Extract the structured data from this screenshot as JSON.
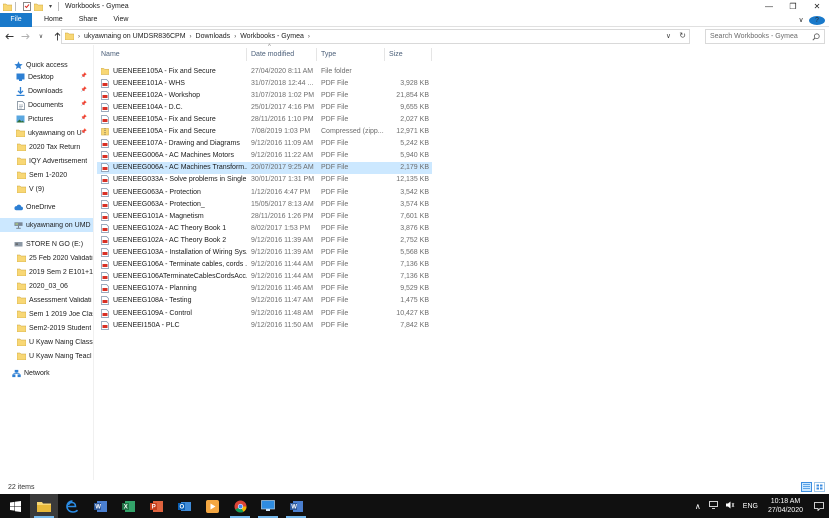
{
  "window": {
    "title": "Workbooks - Gymea",
    "controls": [
      "—",
      "❐",
      "✕"
    ]
  },
  "ribbon": {
    "tabs": [
      "File",
      "Home",
      "Share",
      "View"
    ],
    "expand": "∨",
    "help": "?"
  },
  "address": {
    "segments": [
      "ukyawnaing on UMDSR836CPM",
      "Downloads",
      "Workbooks - Gymea"
    ],
    "search_placeholder": "Search Workbooks - Gymea"
  },
  "nav": {
    "items": [
      {
        "label": "Quick access",
        "icon": "star-icon"
      },
      {
        "label": "Desktop",
        "icon": "desktop-icon",
        "pinned": true
      },
      {
        "label": "Downloads",
        "icon": "download-icon",
        "pinned": true
      },
      {
        "label": "Documents",
        "icon": "documents-icon",
        "pinned": true
      },
      {
        "label": "Pictures",
        "icon": "pictures-icon",
        "pinned": true
      },
      {
        "label": "ukyawnaing on U",
        "icon": "user-folder-icon",
        "pinned": true
      },
      {
        "label": "2020 Tax Return",
        "icon": "folder-icon"
      },
      {
        "label": "IQY Advertisement",
        "icon": "folder-icon"
      },
      {
        "label": "Sem 1-2020",
        "icon": "folder-icon"
      },
      {
        "label": "V (9)",
        "icon": "folder-icon"
      },
      {
        "label": "OneDrive",
        "icon": "cloud-icon"
      },
      {
        "label": "ukyawnaing on UMD",
        "icon": "network-drive-icon",
        "selected": true
      },
      {
        "label": "STORE N GO (E:)",
        "icon": "usb-drive-icon"
      },
      {
        "label": "25 Feb 2020 Validati",
        "icon": "folder-icon"
      },
      {
        "label": "2019 Sem 2 E101+1(",
        "icon": "folder-icon"
      },
      {
        "label": "2020_03_06",
        "icon": "folder-icon"
      },
      {
        "label": "Assessment Validati",
        "icon": "folder-icon"
      },
      {
        "label": "Sem 1 2019 Joe Clas",
        "icon": "folder-icon"
      },
      {
        "label": "Sem2-2019 Student",
        "icon": "folder-icon"
      },
      {
        "label": "U Kyaw Naing Class",
        "icon": "folder-icon"
      },
      {
        "label": "U Kyaw Naing Teacl",
        "icon": "folder-icon"
      },
      {
        "label": "Network",
        "icon": "network-icon"
      }
    ]
  },
  "columns": {
    "name": "Name",
    "date": "Date modified",
    "type": "Type",
    "size": "Size"
  },
  "files": [
    {
      "name": "UEENEEE105A - Fix and Secure",
      "date": "27/04/2020 8:11 AM",
      "type": "File folder",
      "size": "",
      "icon": "folder"
    },
    {
      "name": "UEENEEE101A - WHS",
      "date": "31/07/2018 12:44 ...",
      "type": "PDF File",
      "size": "3,928 KB",
      "icon": "pdf"
    },
    {
      "name": "UEENEEE102A - Workshop",
      "date": "31/07/2018 1:02 PM",
      "type": "PDF File",
      "size": "21,854 KB",
      "icon": "pdf"
    },
    {
      "name": "UEENEEE104A - D.C.",
      "date": "25/01/2017 4:16 PM",
      "type": "PDF File",
      "size": "9,655 KB",
      "icon": "pdf"
    },
    {
      "name": "UEENEEE105A - Fix and Secure",
      "date": "28/11/2016 1:10 PM",
      "type": "PDF File",
      "size": "2,027 KB",
      "icon": "pdf"
    },
    {
      "name": "UEENEEE105A - Fix and Secure",
      "date": "7/08/2019 1:03 PM",
      "type": "Compressed (zipp...",
      "size": "12,971 KB",
      "icon": "zip"
    },
    {
      "name": "UEENEEE107A - Drawing and Diagrams",
      "date": "9/12/2016 11:09 AM",
      "type": "PDF File",
      "size": "5,242 KB",
      "icon": "pdf"
    },
    {
      "name": "UEENEEG006A - AC Machines Motors",
      "date": "9/12/2016 11:22 AM",
      "type": "PDF File",
      "size": "5,940 KB",
      "icon": "pdf"
    },
    {
      "name": "UEENEEG006A - AC Machines Transform...",
      "date": "20/07/2017 9:25 AM",
      "type": "PDF File",
      "size": "2,179 KB",
      "icon": "pdf",
      "selected": true
    },
    {
      "name": "UEENEEG033A - Solve problems in Single...",
      "date": "30/01/2017 1:31 PM",
      "type": "PDF File",
      "size": "12,135 KB",
      "icon": "pdf"
    },
    {
      "name": "UEENEEG063A - Protection",
      "date": "1/12/2016 4:47 PM",
      "type": "PDF File",
      "size": "3,542 KB",
      "icon": "pdf"
    },
    {
      "name": "UEENEEG063A - Protection_",
      "date": "15/05/2017 8:13 AM",
      "type": "PDF File",
      "size": "3,574 KB",
      "icon": "pdf"
    },
    {
      "name": "UEENEEG101A - Magnetism",
      "date": "28/11/2016 1:26 PM",
      "type": "PDF File",
      "size": "7,601 KB",
      "icon": "pdf"
    },
    {
      "name": "UEENEEG102A - AC Theory Book 1",
      "date": "8/02/2017 1:53 PM",
      "type": "PDF File",
      "size": "3,876 KB",
      "icon": "pdf"
    },
    {
      "name": "UEENEEG102A - AC Theory Book 2",
      "date": "9/12/2016 11:39 AM",
      "type": "PDF File",
      "size": "2,752 KB",
      "icon": "pdf"
    },
    {
      "name": "UEENEEG103A - Installation of Wiring Sys...",
      "date": "9/12/2016 11:39 AM",
      "type": "PDF File",
      "size": "5,568 KB",
      "icon": "pdf"
    },
    {
      "name": "UEENEEG106A - Terminate cables, cords ...",
      "date": "9/12/2016 11:44 AM",
      "type": "PDF File",
      "size": "7,136 KB",
      "icon": "pdf"
    },
    {
      "name": "UEENEEG106ATerminateCablesCordsAcc...",
      "date": "9/12/2016 11:44 AM",
      "type": "PDF File",
      "size": "7,136 KB",
      "icon": "pdf"
    },
    {
      "name": "UEENEEG107A - Planning",
      "date": "9/12/2016 11:46 AM",
      "type": "PDF File",
      "size": "9,529 KB",
      "icon": "pdf"
    },
    {
      "name": "UEENEEG108A - Testing",
      "date": "9/12/2016 11:47 AM",
      "type": "PDF File",
      "size": "1,475 KB",
      "icon": "pdf"
    },
    {
      "name": "UEENEEG109A - Control",
      "date": "9/12/2016 11:48 AM",
      "type": "PDF File",
      "size": "10,427 KB",
      "icon": "pdf"
    },
    {
      "name": "UEENEEI150A - PLC",
      "date": "9/12/2016 11:50 AM",
      "type": "PDF File",
      "size": "7,842 KB",
      "icon": "pdf"
    }
  ],
  "status": {
    "count": "22 items"
  },
  "taskbar": {
    "apps": [
      "file-explorer",
      "edge",
      "word",
      "excel",
      "powerpoint",
      "outlook",
      "media-player",
      "chrome",
      "remote-desktop",
      "word-2"
    ],
    "lang": "ENG",
    "time": "10:18 AM",
    "date": "27/04/2020"
  },
  "colors": {
    "accent": "#1979ca",
    "selection": "#cce8ff",
    "folder": "#f8d775",
    "pdf": "#d93025",
    "taskbar": "#101010"
  }
}
